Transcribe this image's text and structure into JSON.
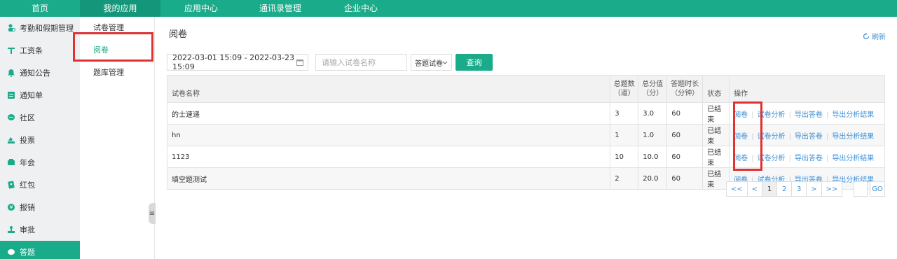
{
  "top_nav": [
    "首页",
    "我的应用",
    "应用中心",
    "通讯录管理",
    "企业中心"
  ],
  "sidebar": [
    {
      "label": "考勤和假期管理",
      "icon": "attendance-icon"
    },
    {
      "label": "工资条",
      "icon": "salary-icon"
    },
    {
      "label": "通知公告",
      "icon": "bell-icon"
    },
    {
      "label": "通知单",
      "icon": "notice-icon"
    },
    {
      "label": "社区",
      "icon": "chat-icon"
    },
    {
      "label": "投票",
      "icon": "vote-icon"
    },
    {
      "label": "年会",
      "icon": "party-icon"
    },
    {
      "label": "红包",
      "icon": "red-packet-icon"
    },
    {
      "label": "报销",
      "icon": "reimburse-icon"
    },
    {
      "label": "审批",
      "icon": "approval-icon"
    },
    {
      "label": "答题",
      "icon": "quiz-icon"
    }
  ],
  "submenu": [
    "试卷管理",
    "阅卷",
    "题库管理"
  ],
  "main": {
    "title": "阅卷",
    "refresh_label": "刷新",
    "date_range": "2022-03-01 15:09 - 2022-03-23 15:09",
    "search_placeholder": "请输入试卷名称",
    "select_value": "答题试卷",
    "query_label": "查询"
  },
  "table": {
    "headers": {
      "name": "试卷名称",
      "count": [
        "总题数",
        "（道）"
      ],
      "score": [
        "总分值",
        "（分）"
      ],
      "duration": [
        "答题时长",
        "（分钟）"
      ],
      "status": "状态",
      "ops": "操作"
    },
    "rows": [
      {
        "name": "的士速递",
        "count": "3",
        "score": "3.0",
        "duration": "60",
        "status": "已结束"
      },
      {
        "name": "hn",
        "count": "1",
        "score": "1.0",
        "duration": "60",
        "status": "已结束"
      },
      {
        "name": "1123",
        "count": "10",
        "score": "10.0",
        "duration": "60",
        "status": "已结束"
      },
      {
        "name": "填空题测试",
        "count": "2",
        "score": "20.0",
        "duration": "60",
        "status": "已结束"
      }
    ],
    "ops": [
      "阅卷",
      "试卷分析",
      "导出答卷",
      "导出分析结果"
    ]
  },
  "pagination": {
    "first": "<<",
    "prev": "<",
    "pages": [
      "1",
      "2",
      "3"
    ],
    "next": ">",
    "last": ">>",
    "go": "GO",
    "current": "1"
  },
  "colors": {
    "brand": "#1aab8a",
    "highlight": "#e03232",
    "link": "#3b8fd6"
  }
}
